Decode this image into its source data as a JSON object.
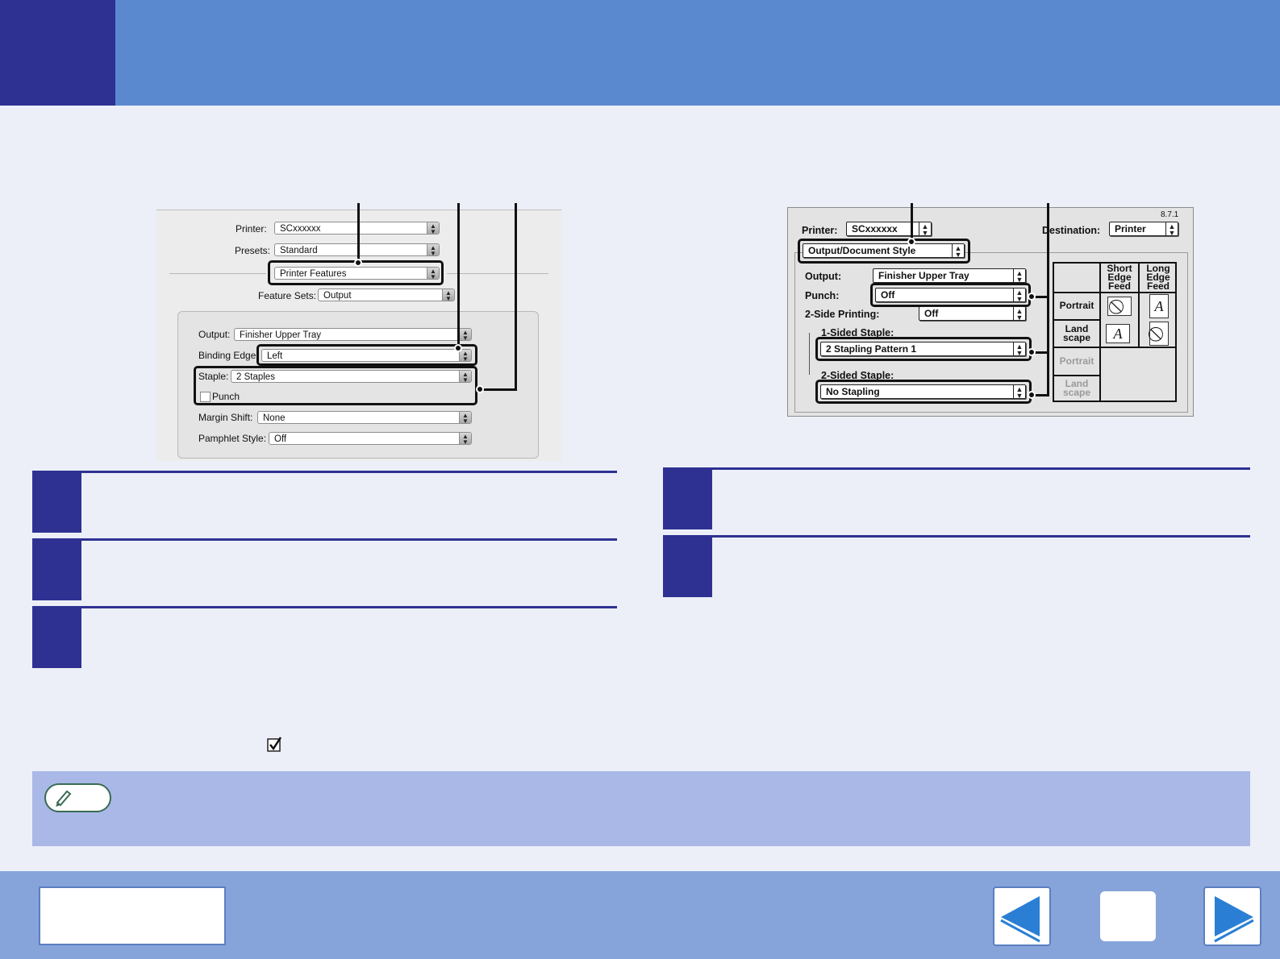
{
  "mac_osx_dialog": {
    "printer_label": "Printer:",
    "printer_value": "SCxxxxxx",
    "presets_label": "Presets:",
    "presets_value": "Standard",
    "panel_value": "Printer Features",
    "feature_sets_label": "Feature Sets:",
    "feature_sets_value": "Output",
    "output_label": "Output:",
    "output_value": "Finisher Upper Tray",
    "binding_edge_label": "Binding Edge",
    "binding_edge_value": "Left",
    "staple_label": "Staple:",
    "staple_value": "2 Staples",
    "punch_label": "Punch",
    "margin_shift_label": "Margin Shift:",
    "margin_shift_value": "None",
    "pamphlet_style_label": "Pamphlet Style:",
    "pamphlet_style_value": "Off"
  },
  "mac_os9_dialog": {
    "version": "8.7.1",
    "printer_label": "Printer:",
    "printer_value": "SCxxxxxx",
    "destination_label": "Destination:",
    "destination_value": "Printer",
    "panel_value": "Output/Document Style",
    "output_label": "Output:",
    "output_value": "Finisher Upper Tray",
    "punch_label": "Punch:",
    "punch_value": "Off",
    "two_side_label": "2-Side Printing:",
    "two_side_value": "Off",
    "one_sided_staple_label": "1-Sided Staple:",
    "one_sided_staple_value": "2 Stapling  Pattern 1",
    "two_sided_staple_label": "2-Sided Staple:",
    "two_sided_staple_value": "No Stapling",
    "grid": {
      "short_edge_feed": "Short Edge Feed",
      "long_edge_feed": "Long Edge Feed",
      "portrait": "Portrait",
      "landscape": "Land scape",
      "portrait_disabled": "Portrait",
      "landscape_disabled": "Land scape"
    }
  },
  "icons": {
    "pencil": "pencil-icon",
    "prev": "left-arrow-icon",
    "next": "right-arrow-icon",
    "checkbox": "checkbox-checked-icon"
  },
  "colors": {
    "header": "#5b89cf",
    "dark_blue": "#2e3192",
    "footer": "#86a4da",
    "note": "#a9b8e6",
    "background": "#eceff8"
  }
}
